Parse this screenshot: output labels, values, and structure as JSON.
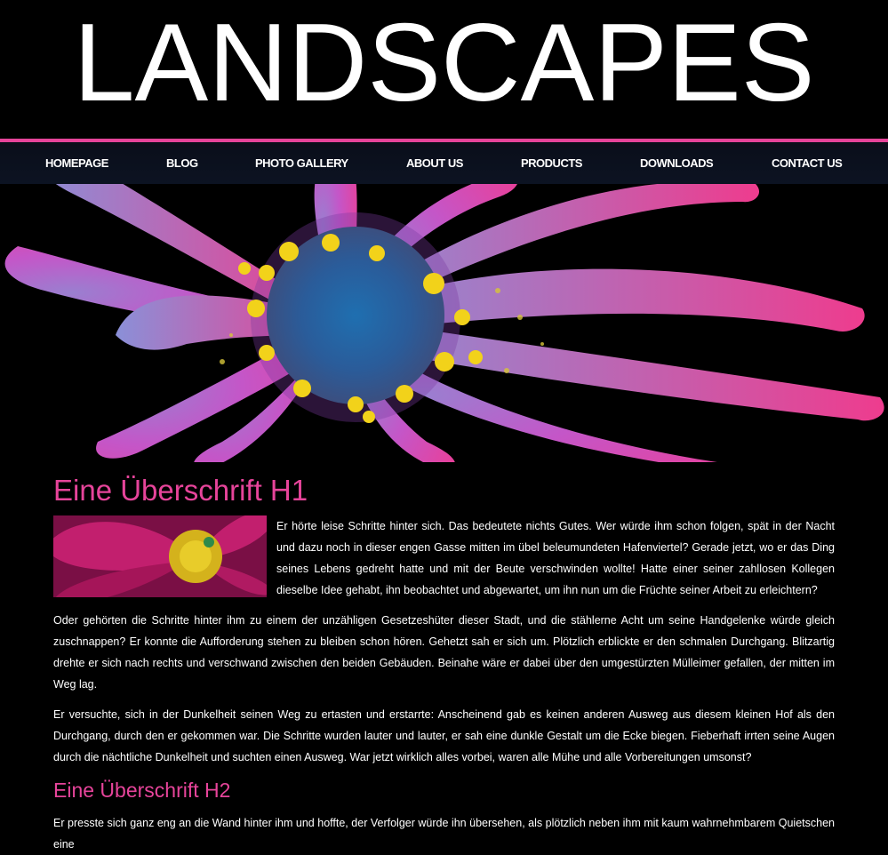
{
  "header": {
    "title": "LANDSCAPES"
  },
  "nav": {
    "items": [
      {
        "label": "HOMEPAGE"
      },
      {
        "label": "BLOG"
      },
      {
        "label": "PHOTO GALLERY"
      },
      {
        "label": "ABOUT US"
      },
      {
        "label": "PRODUCTS"
      },
      {
        "label": "DOWNLOADS"
      },
      {
        "label": "CONTACT US"
      }
    ]
  },
  "content": {
    "h1": "Eine Überschrift H1",
    "h2": "Eine Überschrift H2",
    "paragraphs": [
      "Er hörte leise Schritte hinter sich. Das bedeutete nichts Gutes. Wer würde ihm schon folgen, spät in der Nacht und dazu noch in dieser engen Gasse mitten im übel beleumundeten Hafenviertel? Gerade jetzt, wo er das Ding seines Lebens gedreht hatte und mit der Beute verschwinden wollte! Hatte einer seiner zahllosen Kollegen dieselbe Idee gehabt, ihn beobachtet und abgewartet, um ihn nun um die Früchte seiner Arbeit zu erleichtern?",
      "Oder gehörten die Schritte hinter ihm zu einem der unzähligen Gesetzeshüter dieser Stadt, und die stählerne Acht um seine Handgelenke würde gleich zuschnappen? Er konnte die Aufforderung stehen zu bleiben schon hören. Gehetzt sah er sich um. Plötzlich erblickte er den schmalen Durchgang. Blitzartig drehte er sich nach rechts und verschwand zwischen den beiden Gebäuden. Beinahe wäre er dabei über den umgestürzten Mülleimer gefallen, der mitten im Weg lag.",
      "Er versuchte, sich in der Dunkelheit seinen Weg zu ertasten und erstarrte: Anscheinend gab es keinen anderen Ausweg aus diesem kleinen Hof als den Durchgang, durch den er gekommen war. Die Schritte wurden lauter und lauter, er sah eine dunkle Gestalt um die Ecke biegen. Fieberhaft irrten seine Augen durch die nächtliche Dunkelheit und suchten einen Ausweg. War jetzt wirklich alles vorbei, waren alle Mühe und alle Vorbereitungen umsonst?",
      "Er presste sich ganz eng an die Wand hinter ihm und hoffte, der Verfolger würde ihn übersehen, als plötzlich neben ihm mit kaum wahrnehmbarem Quietschen eine"
    ]
  },
  "colors": {
    "accent": "#e6449a",
    "background": "#000000",
    "nav_bg": "#0c1322"
  }
}
